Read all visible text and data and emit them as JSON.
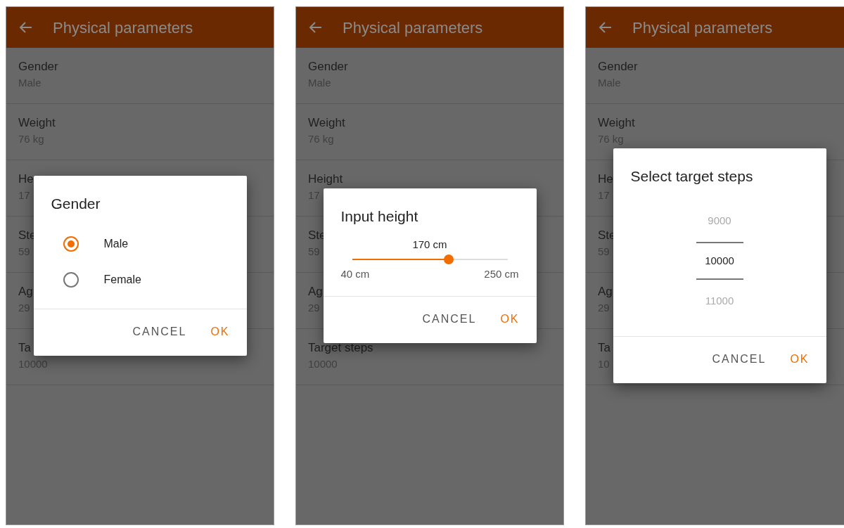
{
  "screens": [
    {
      "header": {
        "title": "Physical parameters"
      },
      "rows": [
        {
          "label": "Gender",
          "value": "Male"
        },
        {
          "label": "Weight",
          "value": "76 kg"
        },
        {
          "label": "He",
          "value": "17"
        },
        {
          "label": "Ste",
          "value": "59"
        },
        {
          "label": "Ag",
          "value": "29"
        },
        {
          "label": "Ta",
          "value": "10000"
        }
      ],
      "dialog": {
        "kind": "radio",
        "title": "Gender",
        "options": [
          {
            "label": "Male",
            "selected": true
          },
          {
            "label": "Female",
            "selected": false
          }
        ],
        "buttons": [
          "CANCEL",
          "OK"
        ]
      }
    },
    {
      "header": {
        "title": "Physical parameters"
      },
      "rows": [
        {
          "label": "Gender",
          "value": "Male"
        },
        {
          "label": "Weight",
          "value": "76 kg"
        },
        {
          "label": "Height",
          "value": "17"
        },
        {
          "label": "Ste",
          "value": "59"
        },
        {
          "label": "Ag",
          "value": "29"
        },
        {
          "label": "Target steps",
          "value": "10000"
        }
      ],
      "dialog": {
        "kind": "slider",
        "title": "Input height",
        "reading": "170 cm",
        "level": 0.62,
        "min_label": "40 cm",
        "max_label": "250 cm",
        "buttons": [
          "CANCEL",
          "OK"
        ]
      }
    },
    {
      "header": {
        "title": "Physical parameters"
      },
      "rows": [
        {
          "label": "Gender",
          "value": "Male"
        },
        {
          "label": "Weight",
          "value": "76 kg"
        },
        {
          "label": "He",
          "value": "17"
        },
        {
          "label": "Ste",
          "value": "59"
        },
        {
          "label": "Ag",
          "value": "29"
        },
        {
          "label": "Ta",
          "value": "10"
        }
      ],
      "dialog": {
        "kind": "picker",
        "title": "Select target steps",
        "options": [
          {
            "label": "9000",
            "selected": false
          },
          {
            "label": "10000",
            "selected": true
          },
          {
            "label": "11000",
            "selected": false
          }
        ],
        "buttons": [
          "CANCEL",
          "OK"
        ]
      }
    }
  ]
}
